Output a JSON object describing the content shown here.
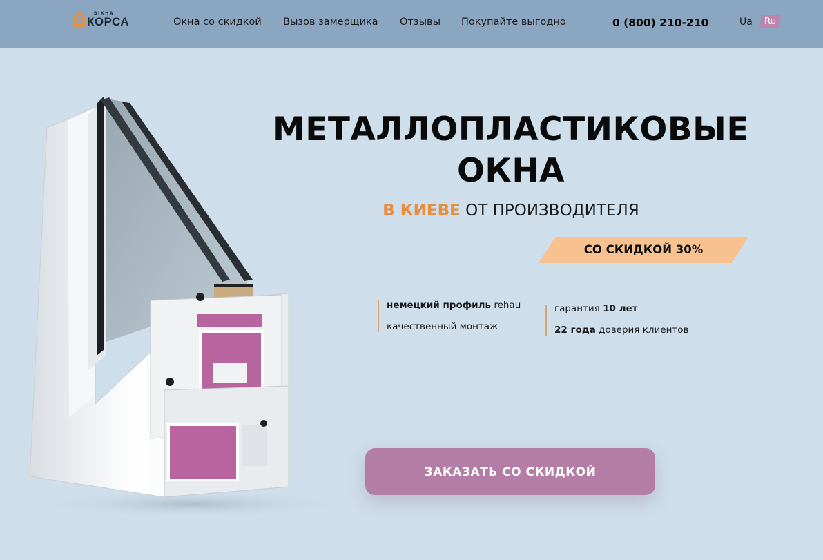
{
  "header": {
    "logo": {
      "small": "ВІКНА",
      "name": "КОРСА"
    },
    "nav": [
      {
        "label": "Окна со скидкой"
      },
      {
        "label": "Вызов замерщика"
      },
      {
        "label": "Отзывы"
      },
      {
        "label": "Покупайте выгодно"
      }
    ],
    "phone": "0 (800) 210-210",
    "languages": {
      "ua": "Ua",
      "ru": "Ru",
      "active": "Ru"
    }
  },
  "hero": {
    "title_line1": "МЕТАЛЛОПЛАСТИКОВЫЕ",
    "title_line2": "ОКНА",
    "subtitle_accent": "В КИЕВЕ",
    "subtitle_rest": "ОТ ПРОИЗВОДИТЕЛЯ",
    "discount": "СО СКИДКОЙ 30%",
    "features_left": [
      {
        "bold": "немецкий профиль",
        "text": "rehau"
      },
      {
        "bold": "",
        "text": "качественный монтаж"
      }
    ],
    "features_right": [
      {
        "text": "гарантия",
        "bold": "10 лет"
      },
      {
        "bold": "22 года",
        "text": "доверия клиентов"
      }
    ],
    "cta": "ЗАКАЗАТЬ СО СКИДКОЙ"
  },
  "colors": {
    "background": "#cedeeb",
    "header": "#8aa6c0",
    "accent_orange": "#e68d3e",
    "discount_bg": "#f8c290",
    "cta_bg": "#b47da6",
    "lang_active_bg": "#bd85ad",
    "profile_pink": "#b8659f"
  }
}
